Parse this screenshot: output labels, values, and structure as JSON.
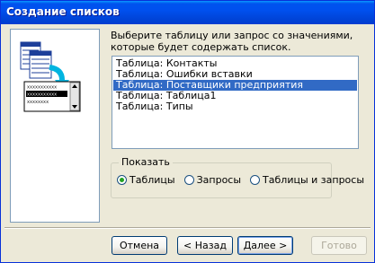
{
  "window": {
    "title": "Создание списков"
  },
  "prompt": "Выберите таблицу или запрос со значениями, которые будет содержать список.",
  "list": {
    "items": [
      "Таблица: Контакты",
      "Таблица: Ошибки вставки",
      "Таблица: Поставщики предприятия",
      "Таблица: Таблица1",
      "Таблица: Типы"
    ],
    "selected_index": 2
  },
  "show_group": {
    "legend": "Показать",
    "options": [
      "Таблицы",
      "Запросы",
      "Таблицы и запросы"
    ],
    "selected_index": 0
  },
  "buttons": {
    "cancel": "Отмена",
    "back": "< Назад",
    "next": "Далее >",
    "finish": "Готово"
  },
  "colors": {
    "selection": "#316ac5",
    "titlebar": "#0050ee",
    "dialog_bg": "#ece9d8"
  }
}
